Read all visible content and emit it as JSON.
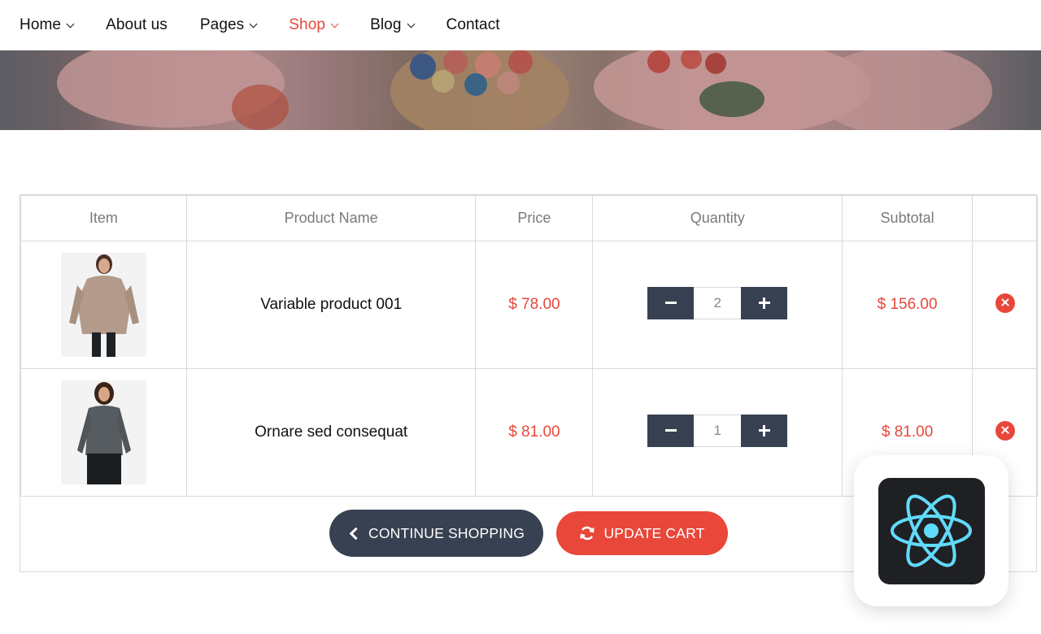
{
  "nav": {
    "items": [
      {
        "label": "Home",
        "dropdown": true,
        "active": false
      },
      {
        "label": "About us",
        "dropdown": false,
        "active": false
      },
      {
        "label": "Pages",
        "dropdown": true,
        "active": false
      },
      {
        "label": "Shop",
        "dropdown": true,
        "active": true
      },
      {
        "label": "Blog",
        "dropdown": true,
        "active": false
      },
      {
        "label": "Contact",
        "dropdown": false,
        "active": false
      }
    ]
  },
  "cart": {
    "headers": [
      "Item",
      "Product Name",
      "Price",
      "Quantity",
      "Subtotal",
      ""
    ],
    "rows": [
      {
        "name": "Variable product 001",
        "price": "$ 78.00",
        "quantity": "2",
        "subtotal": "$ 156.00"
      },
      {
        "name": "Ornare sed consequat",
        "price": "$ 81.00",
        "quantity": "1",
        "subtotal": "$ 81.00"
      }
    ],
    "continue_label": "CONTINUE SHOPPING",
    "update_label": "UPDATE CART"
  },
  "colors": {
    "accent": "#e8473a",
    "dark": "#374151",
    "react": "#61dafb"
  },
  "icons": {
    "minus": "minus-icon",
    "plus": "plus-icon",
    "remove": "remove-circle-icon",
    "continue": "chevron-left-icon",
    "update": "refresh-icon",
    "badge": "react-logo-icon"
  }
}
